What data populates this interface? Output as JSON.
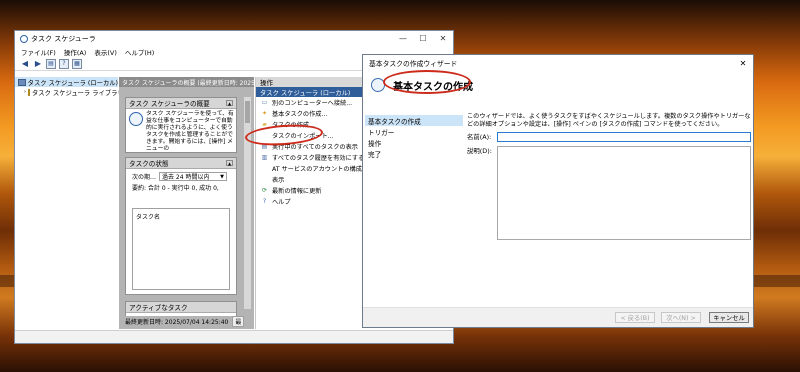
{
  "task_scheduler": {
    "title": "タスク スケジューラ",
    "window_controls": [
      "—",
      "☐",
      "✕"
    ],
    "menu": [
      "ファイル(F)",
      "操作(A)",
      "表示(V)",
      "ヘルプ(H)"
    ],
    "tree": [
      {
        "label": "タスク スケジューラ (ローカル)",
        "selected": true
      },
      {
        "label": "タスク スケジューラ ライブラリ",
        "selected": false
      }
    ],
    "middle_header": "タスク スケジューラの概要 (最終更新日時: 2025",
    "overview_title": "タスク スケジューラの概要",
    "overview_text": "タスク スケジューラを使って、有益な仕事をコンピューターで自動的に実行されるように、よく使うタスクを作成と管理することができます。開始するには、[操作] メニューの",
    "status_title": "タスクの状態",
    "status_label": "次の期…",
    "status_select": "過去 24 時間以内",
    "summary": "要約: 合計 0 - 実行中 0, 成功 0,",
    "task_name_header": "タスク名",
    "active_tasks_title": "アクティブなタスク",
    "last_updated": "最終更新日時: 2025/07/04 14:25:40",
    "refresh_short": "最",
    "actions_header": "操作",
    "actions_subheader": "タスク スケジューラ (ローカル)",
    "actions": [
      {
        "label": "別のコンピューターへ接続...",
        "icon": "computer-icon"
      },
      {
        "label": "基本タスクの作成...",
        "icon": "basic-task-icon"
      },
      {
        "label": "タスクの作成...",
        "icon": "folder-icon"
      },
      {
        "label": "タスクのインポート...",
        "icon": "blank"
      },
      {
        "label": "実行中のすべてのタスクの表示",
        "icon": "list-icon"
      },
      {
        "label": "すべてのタスク履歴を有効にする",
        "icon": "history-icon"
      },
      {
        "label": "AT サービスのアカウントの構成",
        "icon": "blank"
      },
      {
        "label": "表示",
        "icon": "blank"
      },
      {
        "label": "最新の情報に更新",
        "icon": "refresh-icon"
      },
      {
        "label": "ヘルプ",
        "icon": "help-icon"
      }
    ]
  },
  "wizard": {
    "title": "基本タスクの作成ウィザード",
    "close": "✕",
    "heading": "基本タスクの作成",
    "steps": [
      {
        "label": "基本タスクの作成",
        "active": true
      },
      {
        "label": "トリガー",
        "active": false
      },
      {
        "label": "操作",
        "active": false
      },
      {
        "label": "完了",
        "active": false
      }
    ],
    "description": "このウィザードでは、よく使うタスクをすばやくスケジュールします。複数のタスク操作やトリガーなどの詳細オプションや設定は、[操作] ペインの [タスクの作成] コマンドを使ってください。",
    "name_label": "名前(A):",
    "name_value": "",
    "desc_label": "説明(D):",
    "desc_value": "",
    "buttons": {
      "back": "< 戻る(B)",
      "next": "次へ(N) >",
      "cancel": "キャンセル"
    }
  },
  "accent": "#2f5d9a",
  "annotation_color": "#cc2a1a"
}
